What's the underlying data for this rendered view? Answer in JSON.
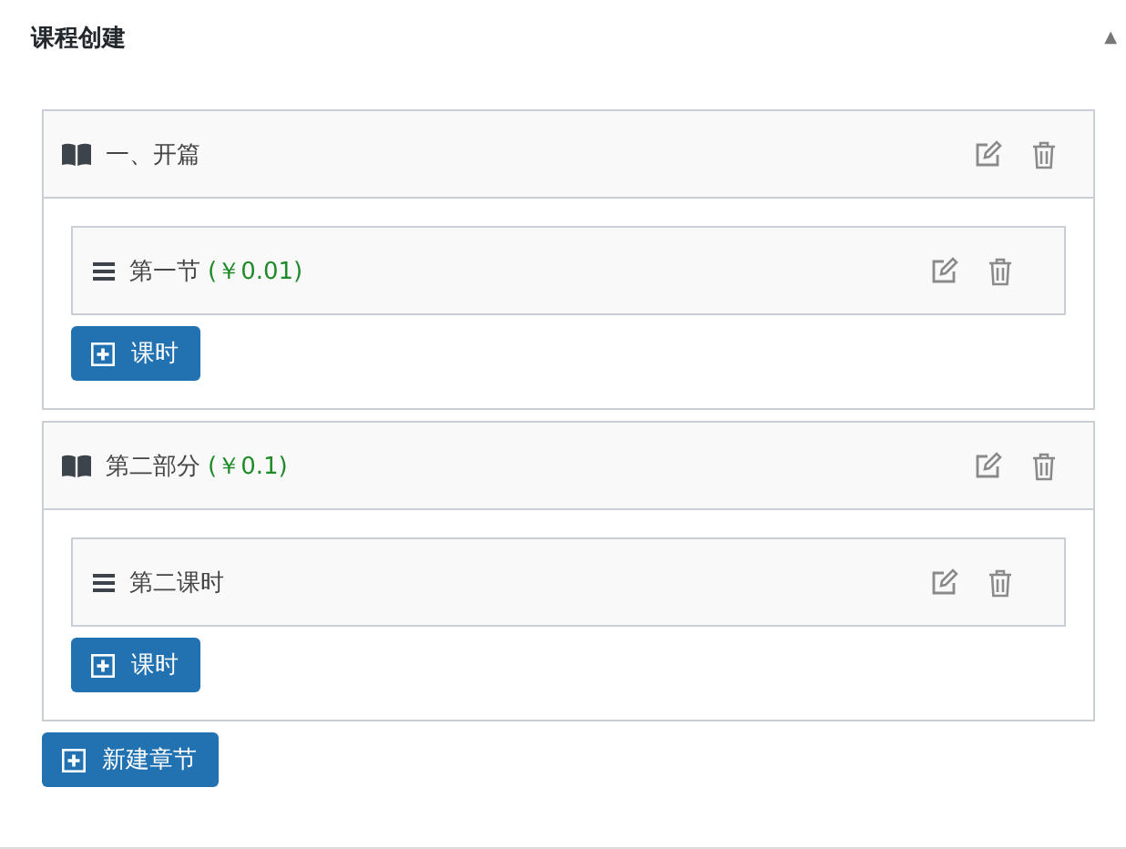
{
  "panel": {
    "title": "课程创建",
    "collapse_toggle": "▲"
  },
  "chapters": [
    {
      "title": "一、开篇",
      "lessons": [
        {
          "title": "第一节",
          "price": "(￥0.01)"
        }
      ],
      "add_lesson_button": "课时"
    },
    {
      "title": "第二部分",
      "price": "(￥0.1)",
      "lessons": [
        {
          "title": "第二课时"
        }
      ],
      "add_lesson_button": "课时"
    }
  ],
  "add_chapter_button": "新建章节"
}
